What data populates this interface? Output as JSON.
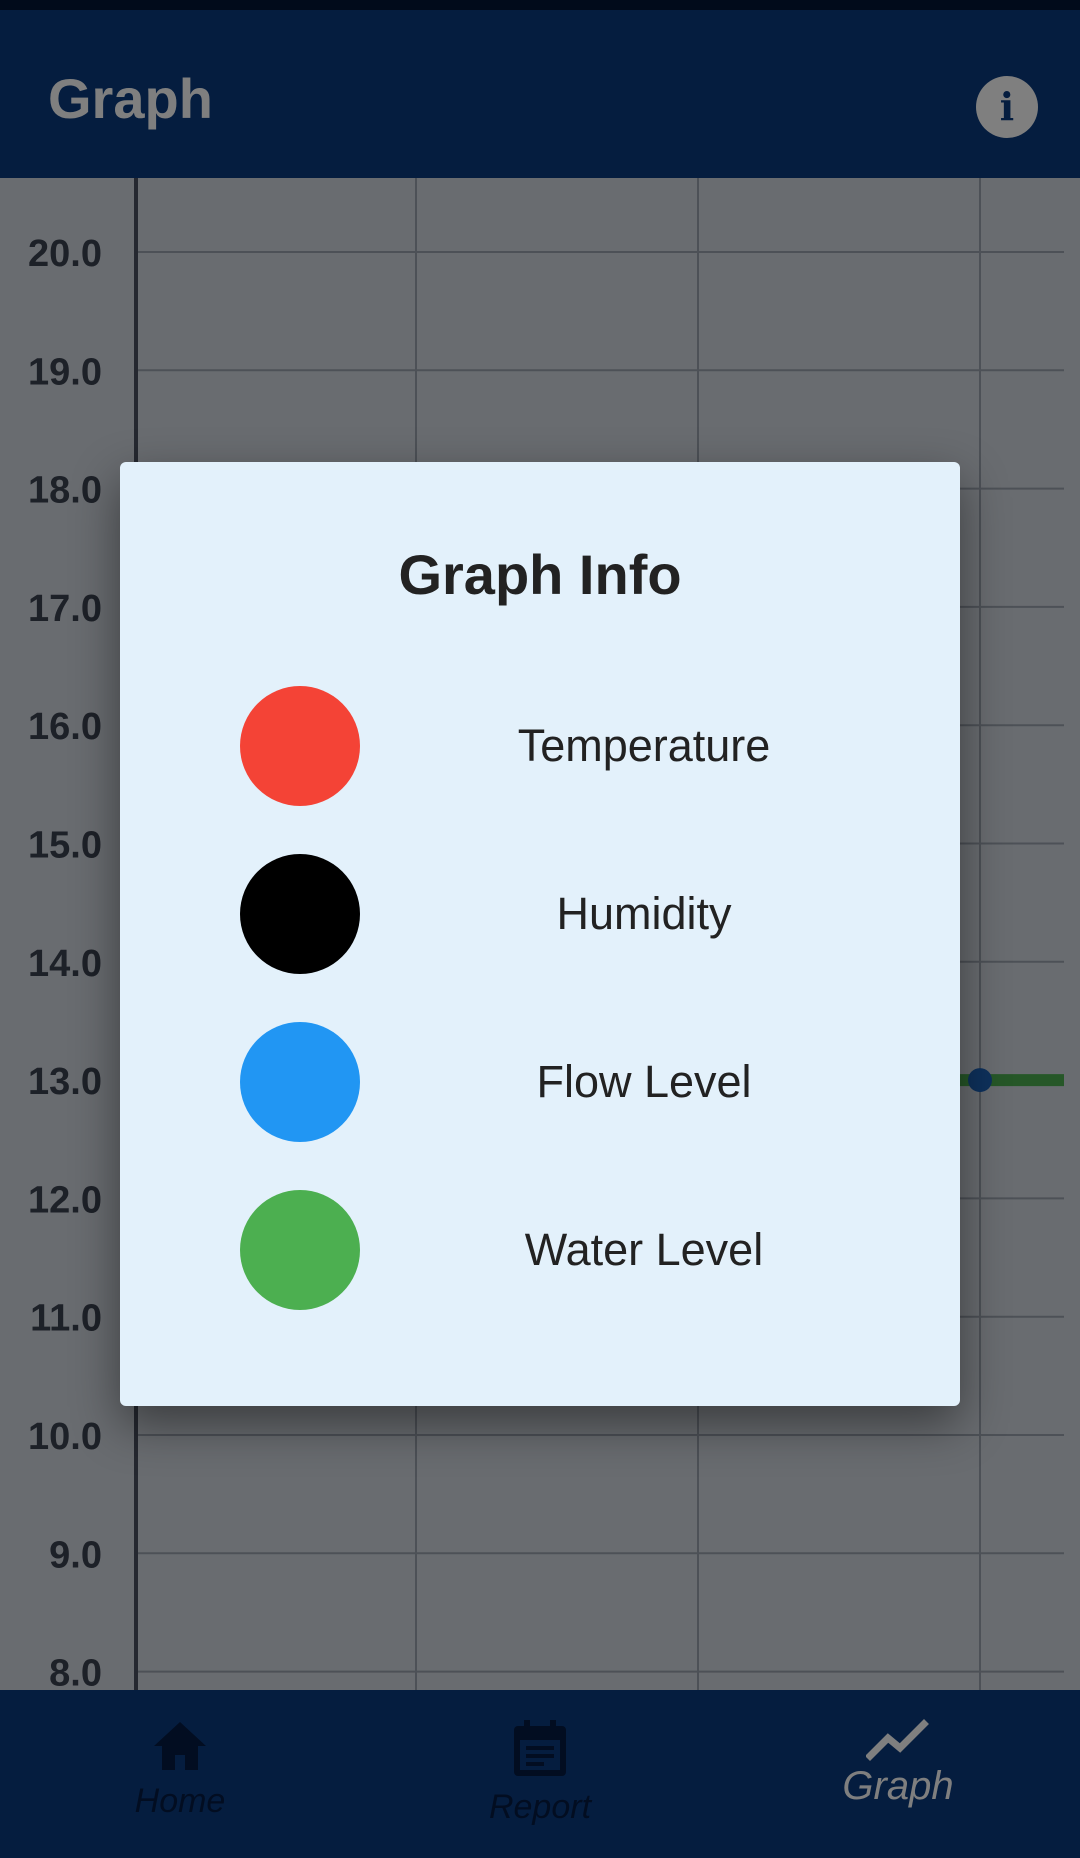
{
  "app_bar": {
    "title": "Graph",
    "info_icon": "info-icon"
  },
  "chart": {
    "y_ticks": [
      "20.0",
      "19.0",
      "18.0",
      "17.0",
      "16.0",
      "15.0",
      "14.0",
      "13.0",
      "12.0",
      "11.0",
      "10.0",
      "9.0",
      "8.0"
    ]
  },
  "chart_data": {
    "type": "line",
    "ylim": [
      8,
      20
    ],
    "series": [
      {
        "color": "#4caf50",
        "values": [
          13.0
        ]
      }
    ]
  },
  "dialog": {
    "title": "Graph Info",
    "legend": [
      {
        "label": "Temperature",
        "color": "#f44336"
      },
      {
        "label": "Humidity",
        "color": "#000000"
      },
      {
        "label": "Flow Level",
        "color": "#2196f3"
      },
      {
        "label": "Water Level",
        "color": "#4caf50"
      }
    ]
  },
  "bottom_nav": {
    "items": [
      {
        "label": "Home",
        "icon": "home-icon"
      },
      {
        "label": "Report",
        "icon": "calendar-icon"
      },
      {
        "label": "Graph",
        "icon": "trend-icon",
        "active": true
      }
    ]
  }
}
